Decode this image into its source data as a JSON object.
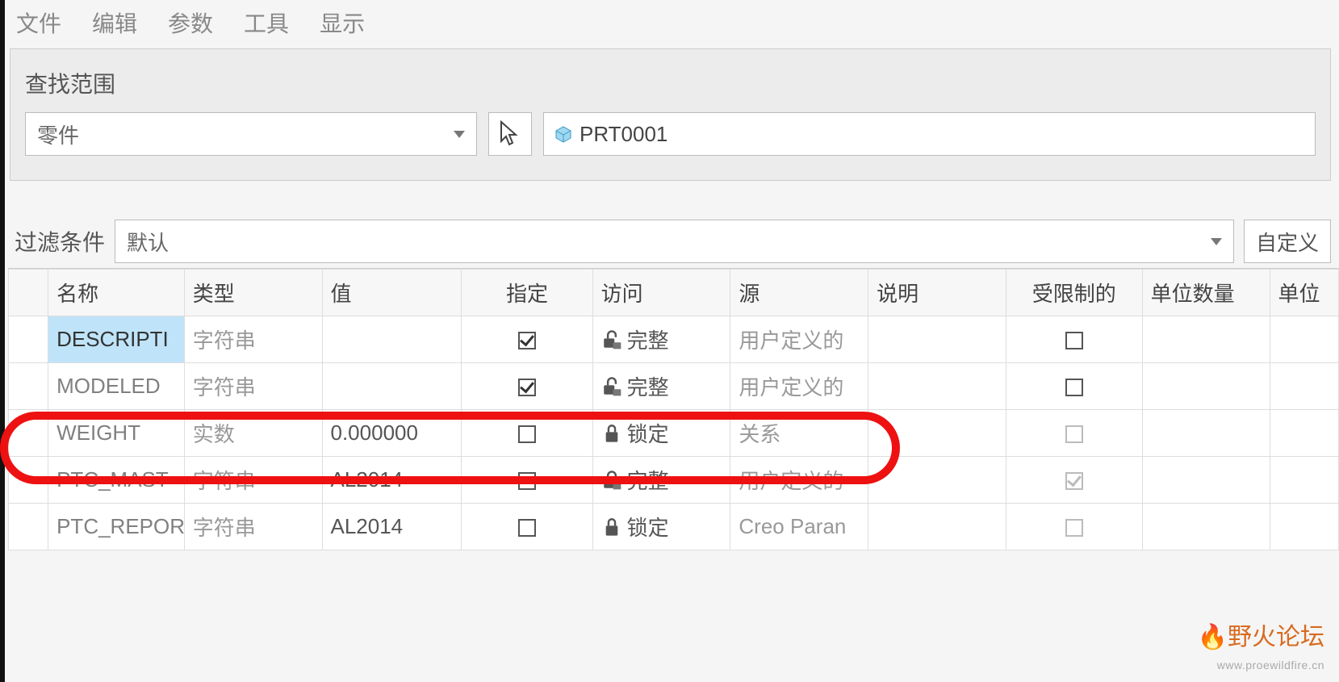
{
  "menu": {
    "file": "文件",
    "edit": "编辑",
    "params": "参数",
    "tools": "工具",
    "display": "显示"
  },
  "scope": {
    "label": "查找范围",
    "type_dd": "零件",
    "part_name": "PRT0001"
  },
  "filter": {
    "label": "过滤条件",
    "dd": "默认",
    "custom": "自定义"
  },
  "columns": {
    "name": "名称",
    "type": "类型",
    "value": "值",
    "spec": "指定",
    "access": "访问",
    "source": "源",
    "desc": "说明",
    "restricted": "受限制的",
    "qty": "单位数量",
    "unit": "单位"
  },
  "rows": [
    {
      "name": "DESCRIPTION",
      "name_display": "DESCRIPTI",
      "type": "字符串",
      "value": "",
      "spec": true,
      "access_icon": "unlocked",
      "access": "完整",
      "source": "用户定义的",
      "restricted": false,
      "restricted_dim": false,
      "selected": true
    },
    {
      "name": "MODELED",
      "name_display": "MODELED",
      "type": "字符串",
      "value": "",
      "spec": true,
      "access_icon": "unlocked",
      "access": "完整",
      "source": "用户定义的",
      "restricted": false,
      "restricted_dim": false,
      "selected": false
    },
    {
      "name": "WEIGHT",
      "name_display": "WEIGHT",
      "type": "实数",
      "value": "0.000000",
      "spec": false,
      "access_icon": "locked",
      "access": "锁定",
      "source": "关系",
      "restricted": false,
      "restricted_dim": true,
      "selected": false
    },
    {
      "name": "PTC_MASTER",
      "name_display": "PTC_MAST",
      "type": "字符串",
      "value": "AL2014",
      "spec": false,
      "access_icon": "unlocked",
      "access": "完整",
      "source": "用户定义的",
      "restricted": true,
      "restricted_dim": true,
      "selected": false
    },
    {
      "name": "PTC_REPORT",
      "name_display": "PTC_REPOR",
      "type": "字符串",
      "value": "AL2014",
      "spec": false,
      "access_icon": "locked",
      "access": "锁定",
      "source": "Creo Paran",
      "restricted": false,
      "restricted_dim": true,
      "selected": false
    }
  ],
  "watermark": {
    "brand": "野火论坛",
    "url": "www.proewildfire.cn"
  }
}
